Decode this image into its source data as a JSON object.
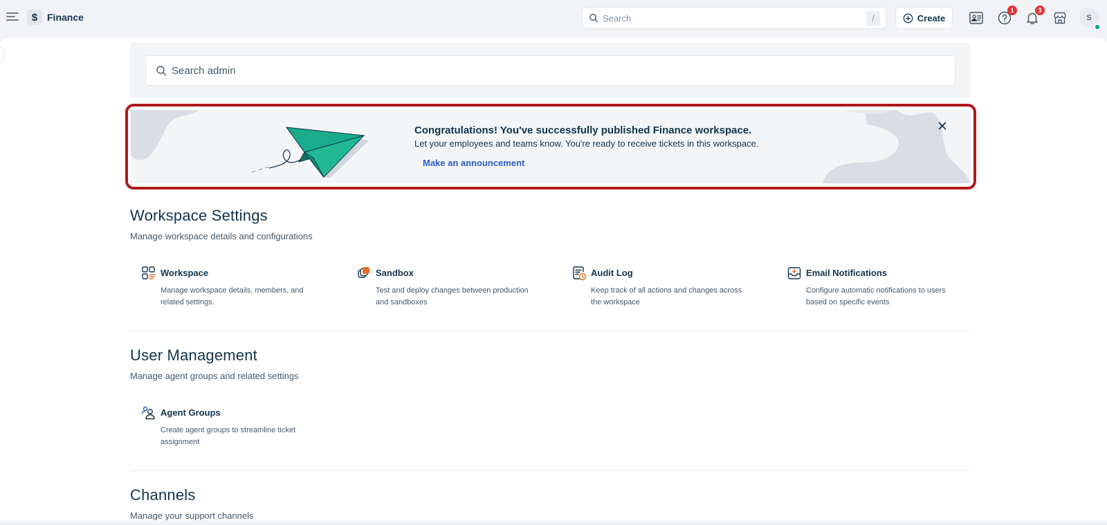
{
  "topbar": {
    "brand_symbol": "$",
    "brand_name": "Finance",
    "search_placeholder": "Search",
    "search_shortcut": "/",
    "create_label": "Create",
    "help_badge": "1",
    "notifications_badge": "3",
    "avatar_initial": "S"
  },
  "admin_search": {
    "placeholder": "Search admin"
  },
  "banner": {
    "title": "Congratulations! You've successfully published Finance workspace.",
    "subtitle": "Let your employees and teams know. You're ready to receive tickets in this workspace.",
    "link_label": "Make an announcement"
  },
  "workspace_settings": {
    "title": "Workspace Settings",
    "description": "Manage workspace details and configurations",
    "cards": [
      {
        "title": "Workspace",
        "description": "Manage workspace details, members, and related settings.",
        "icon": "workspace-grid-icon"
      },
      {
        "title": "Sandbox",
        "description": "Test and deploy changes between production and sandboxes",
        "icon": "sandbox-icon"
      },
      {
        "title": "Audit Log",
        "description": "Keep track of all actions and changes across the workspace",
        "icon": "audit-log-icon"
      },
      {
        "title": "Email Notifications",
        "description": "Configure automatic notifications to users based on specific events",
        "icon": "email-notification-icon"
      }
    ]
  },
  "user_management": {
    "title": "User Management",
    "description": "Manage agent groups and related settings",
    "cards": [
      {
        "title": "Agent Groups",
        "description": "Create agent groups to streamline ticket assignment",
        "icon": "agent-groups-icon"
      }
    ]
  },
  "channels": {
    "title": "Channels",
    "description": "Manage your support channels"
  },
  "colors": {
    "accent": "#2c5cc5",
    "highlight_border": "#b0191c",
    "badge": "#e43538",
    "plane": "#1aab8a",
    "icon_accent": "#e86f25"
  }
}
